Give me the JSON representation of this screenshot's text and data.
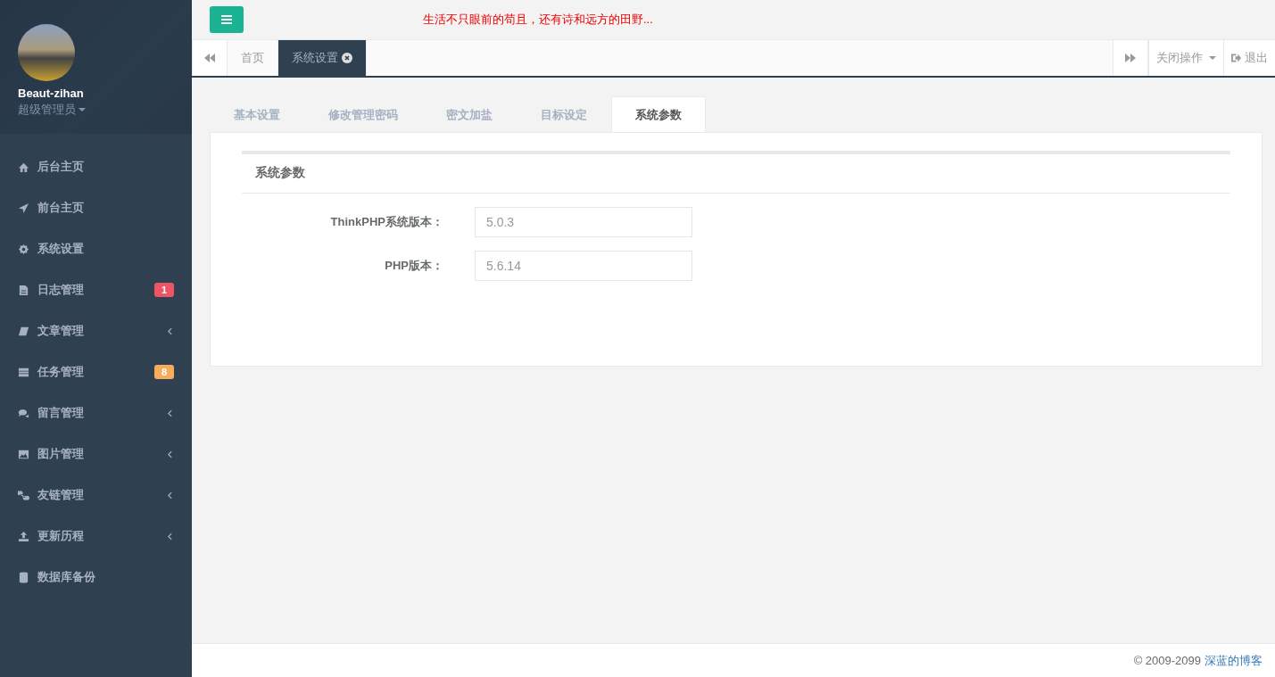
{
  "profile": {
    "name": "Beaut-zihan",
    "role": "超级管理员"
  },
  "sidebar": {
    "items": [
      {
        "label": "后台主页",
        "has_submenu": false
      },
      {
        "label": "前台主页",
        "has_submenu": false
      },
      {
        "label": "系统设置",
        "has_submenu": false
      },
      {
        "label": "日志管理",
        "has_submenu": false,
        "badge": "1",
        "color": "#ed5565"
      },
      {
        "label": "文章管理",
        "has_submenu": true
      },
      {
        "label": "任务管理",
        "has_submenu": false,
        "badge": "8",
        "color": "#f8ac59"
      },
      {
        "label": "留言管理",
        "has_submenu": true
      },
      {
        "label": "图片管理",
        "has_submenu": true
      },
      {
        "label": "友链管理",
        "has_submenu": true
      },
      {
        "label": "更新历程",
        "has_submenu": true
      },
      {
        "label": "数据库备份",
        "has_submenu": false
      }
    ]
  },
  "top_bar": {
    "motto": "生活不只眼前的苟且，还有诗和远方的田野..."
  },
  "page_tabs": [
    {
      "label": "首页",
      "selected": false,
      "closable": false
    },
    {
      "label": "系统设置",
      "selected": true,
      "closable": true
    }
  ],
  "tab_actions": {
    "close_menu": "关闭操作",
    "logout": "退出"
  },
  "settings_tabs": [
    {
      "label": "基本设置",
      "selected": false
    },
    {
      "label": "修改管理密码",
      "selected": false
    },
    {
      "label": "密文加盐",
      "selected": false
    },
    {
      "label": "目标设定",
      "selected": false
    },
    {
      "label": "系统参数",
      "selected": true
    }
  ],
  "panel": {
    "title": "系统参数",
    "fields": [
      {
        "label": "ThinkPHP系统版本：",
        "value": "5.0.3"
      },
      {
        "label": "PHP版本：",
        "value": "5.6.14"
      }
    ]
  },
  "footer": {
    "copyright": "© 2009-2099",
    "link": "深蓝的博客"
  }
}
